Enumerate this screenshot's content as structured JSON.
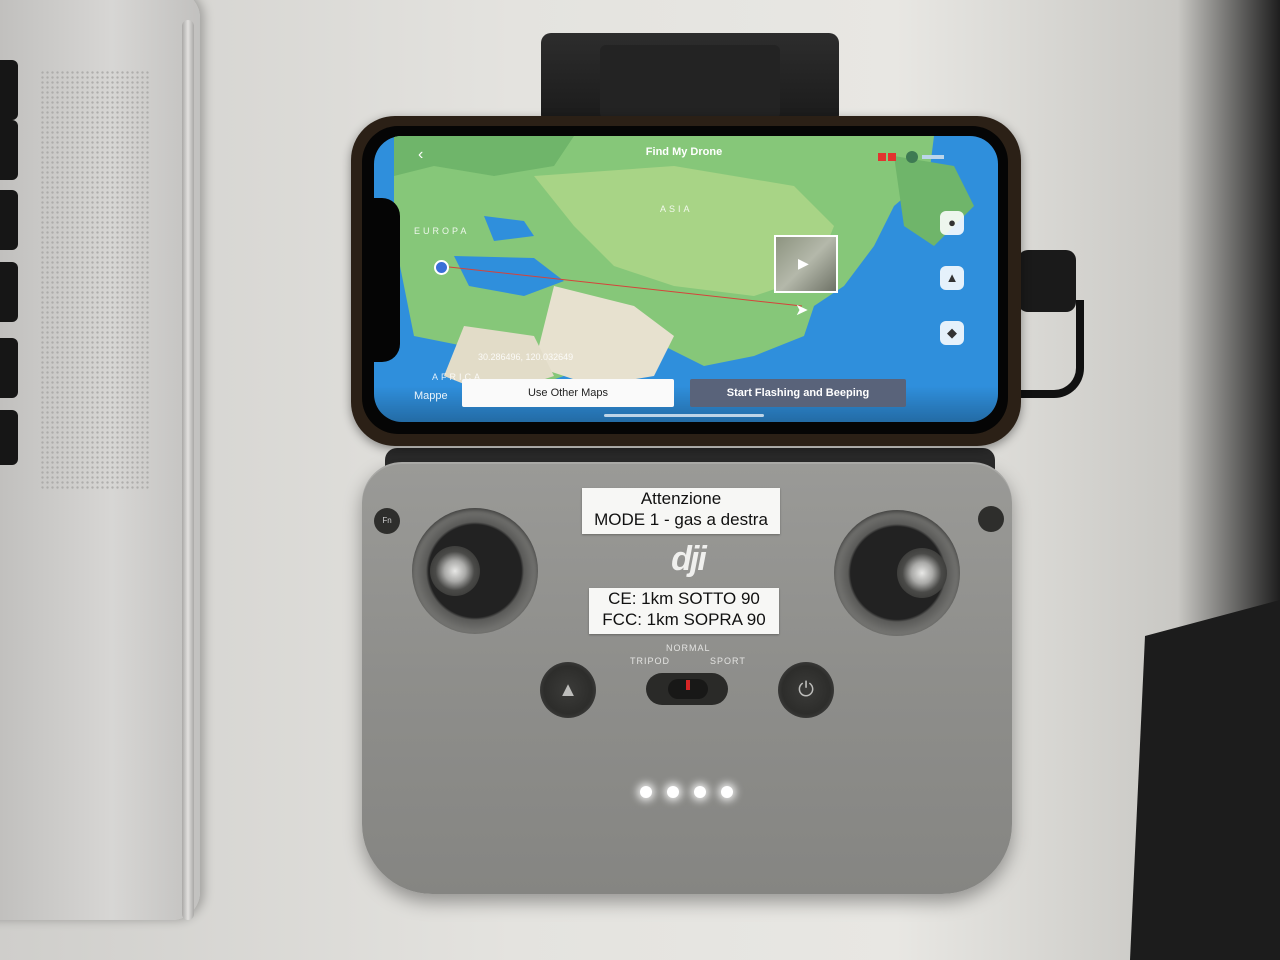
{
  "app": {
    "title": "Find My Drone",
    "map_region_labels": [
      "EUROPA",
      "ASIA",
      "AFRICA"
    ],
    "map_provider": "Mappe",
    "coordinates": "30.286496, 120.032649",
    "buttons": {
      "other_maps": "Use Other Maps",
      "flash_beep": "Start Flashing and Beeping"
    }
  },
  "controller": {
    "brand": "dji",
    "sticker_top": [
      "Attenzione",
      "MODE 1 - gas a destra"
    ],
    "sticker_bottom": [
      "CE: 1km SOTTO 90",
      "FCC: 1km SOPRA 90"
    ],
    "modes": {
      "normal": "NORMAL",
      "tripod": "TRIPOD",
      "sport": "SPORT"
    },
    "fn_label": "Fn",
    "battery_leds": 4
  },
  "icons": [
    "back-chevron-icon",
    "location-pin-icon",
    "compass-icon",
    "layers-icon",
    "power-icon",
    "return-home-icon"
  ]
}
